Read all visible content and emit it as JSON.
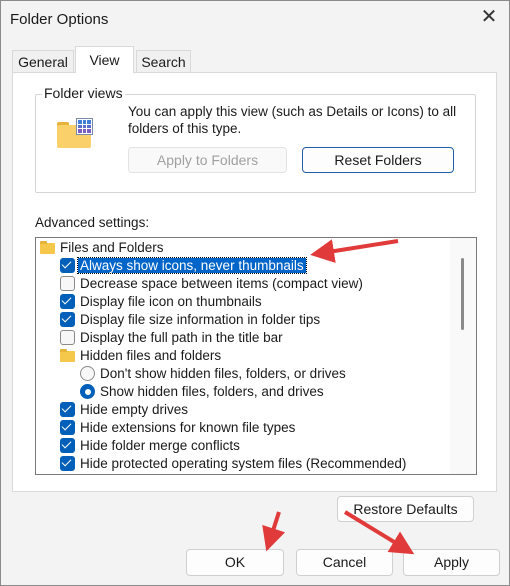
{
  "window": {
    "title": "Folder Options",
    "close_icon": "close-icon"
  },
  "tabs": [
    {
      "label": "General"
    },
    {
      "label": "View",
      "selected": true
    },
    {
      "label": "Search"
    }
  ],
  "folder_views": {
    "label": "Folder views",
    "description_line1": "You can apply this view (such as Details or Icons) to all",
    "description_line2": "folders of this type.",
    "apply_button": "Apply to Folders",
    "reset_button": "Reset Folders"
  },
  "advanced": {
    "label": "Advanced settings:",
    "items": [
      {
        "type": "folder",
        "label": "Files and Folders",
        "indent": 0
      },
      {
        "type": "checkbox",
        "label": "Always show icons, never thumbnails",
        "checked": true,
        "selected": true,
        "indent": 1
      },
      {
        "type": "checkbox",
        "label": "Decrease space between items (compact view)",
        "checked": false,
        "indent": 1
      },
      {
        "type": "checkbox",
        "label": "Display file icon on thumbnails",
        "checked": true,
        "indent": 1
      },
      {
        "type": "checkbox",
        "label": "Display file size information in folder tips",
        "checked": true,
        "indent": 1
      },
      {
        "type": "checkbox",
        "label": "Display the full path in the title bar",
        "checked": false,
        "indent": 1
      },
      {
        "type": "folder",
        "label": "Hidden files and folders",
        "indent": 1
      },
      {
        "type": "radio",
        "label": "Don't show hidden files, folders, or drives",
        "checked": false,
        "indent": 2
      },
      {
        "type": "radio",
        "label": "Show hidden files, folders, and drives",
        "checked": true,
        "indent": 2
      },
      {
        "type": "checkbox",
        "label": "Hide empty drives",
        "checked": true,
        "indent": 1
      },
      {
        "type": "checkbox",
        "label": "Hide extensions for known file types",
        "checked": true,
        "indent": 1
      },
      {
        "type": "checkbox",
        "label": "Hide folder merge conflicts",
        "checked": true,
        "indent": 1
      },
      {
        "type": "checkbox",
        "label": "Hide protected operating system files (Recommended)",
        "checked": true,
        "indent": 1
      }
    ],
    "restore_button": "Restore Defaults"
  },
  "footer": {
    "ok": "OK",
    "cancel": "Cancel",
    "apply": "Apply"
  },
  "colors": {
    "accent": "#005fb8",
    "annotation_arrow": "#e03a3a"
  }
}
